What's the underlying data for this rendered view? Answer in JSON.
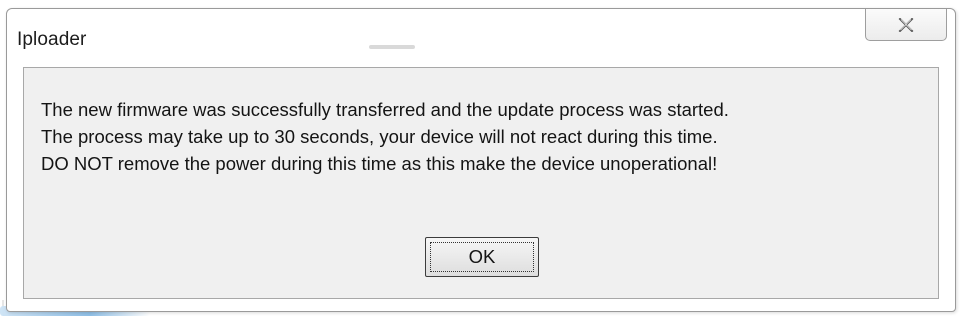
{
  "dialog": {
    "title": "Iploader",
    "close_icon": "close-x-icon",
    "message_lines": [
      "The new firmware was successfully transferred and the update process was started.",
      "The process may take up to 30 seconds, your device will not react during this time.",
      "DO NOT remove the power during this time as this make the device unoperational!"
    ],
    "ok_label": "OK"
  },
  "colors": {
    "client_bg": "#f0f0f0",
    "frame_border": "#9a9a9a",
    "text": "#141414"
  }
}
